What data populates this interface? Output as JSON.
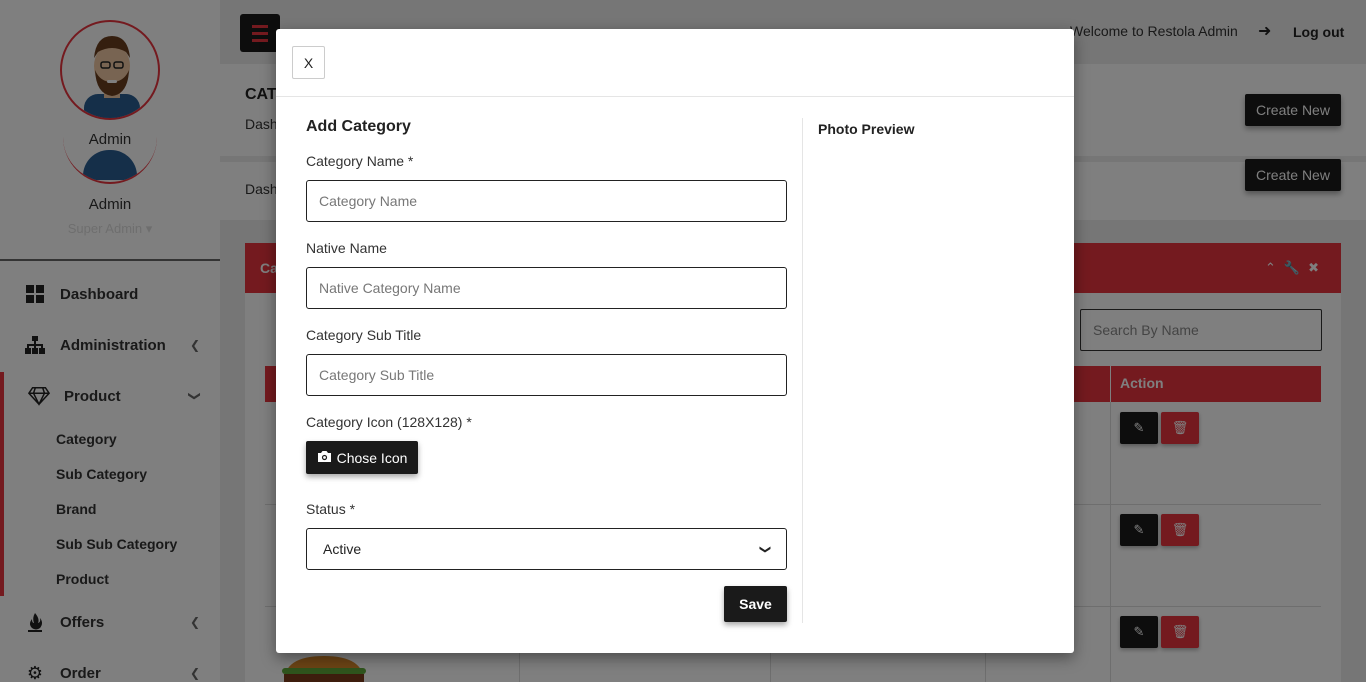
{
  "sidebar": {
    "admin_name": "Admin",
    "admin_name_2": "Admin",
    "admin_role": "Super Admin ▾",
    "items": [
      {
        "label": "Dashboard",
        "icon": "grid-icon"
      },
      {
        "label": "Administration",
        "icon": "sitemap-icon"
      },
      {
        "label": "Product",
        "icon": "diamond-icon"
      },
      {
        "label": "Offers",
        "icon": "fire-icon"
      },
      {
        "label": "Order",
        "icon": "gear-icon"
      }
    ],
    "product_sub": [
      "Category",
      "Sub Category",
      "Brand",
      "Sub Sub Category",
      "Product"
    ]
  },
  "topbar": {
    "welcome": "Welcome to Restola Admin",
    "logout": "Log out"
  },
  "page": {
    "title": "CAT",
    "breadcrumb": "Dash",
    "breadcrumb_2": "Dash",
    "create_new": "Create New",
    "create_new_2": "Create New",
    "panel_title": "Ca",
    "search_placeholder": "Search By Name",
    "table_action_header": "Action"
  },
  "modal": {
    "close": "X",
    "form_title": "Add Category",
    "preview_title": "Photo Preview",
    "fields": {
      "category_name_label": "Category Name *",
      "category_name_placeholder": "Category Name",
      "native_name_label": "Native Name",
      "native_name_placeholder": "Native Category Name",
      "sub_title_label": "Category Sub Title",
      "sub_title_placeholder": "Category Sub Title",
      "icon_label": "Category Icon (128X128) *",
      "icon_button": "Chose Icon",
      "status_label": "Status *",
      "status_value": "Active"
    },
    "save": "Save"
  },
  "colors": {
    "accent": "#e8343f",
    "dark": "#1a1a1a"
  }
}
